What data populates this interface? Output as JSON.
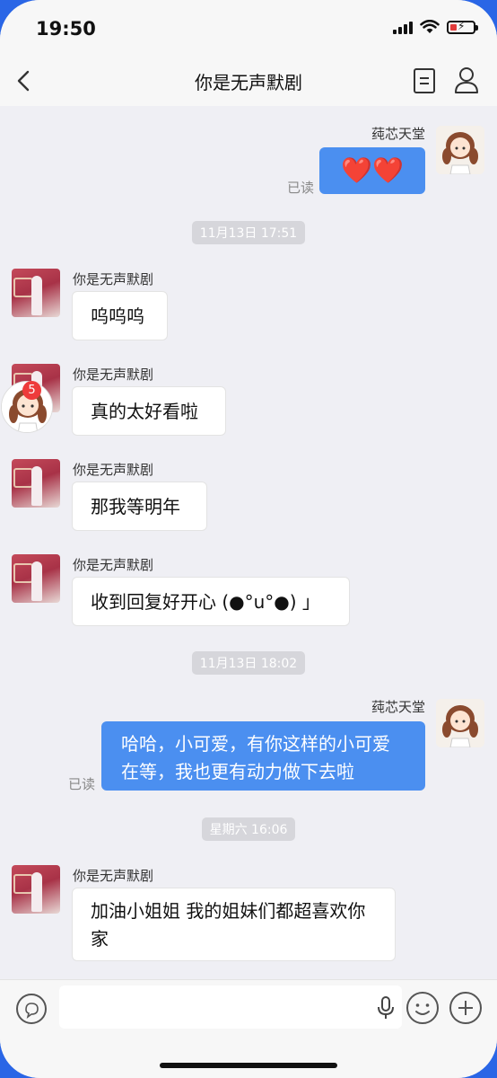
{
  "status_bar": {
    "time": "19:50"
  },
  "header": {
    "title": "你是无声默剧"
  },
  "my_name": "莼芯天堂",
  "their_name": "你是无声默剧",
  "read_label": "已读",
  "messages": [
    {
      "from": "me",
      "text": "❤️❤️",
      "read": true
    },
    {
      "timestamp": "11月13日 17:51"
    },
    {
      "from": "them",
      "text": "呜呜呜"
    },
    {
      "from": "them",
      "text": "真的太好看啦"
    },
    {
      "from": "them",
      "text": "那我等明年"
    },
    {
      "from": "them",
      "text": "收到回复好开心 (●°u°●) 」"
    },
    {
      "timestamp": "11月13日 18:02"
    },
    {
      "from": "me",
      "text": "哈哈，小可爱，有你这样的小可爱在等，我也更有动力做下去啦",
      "read": true
    },
    {
      "timestamp": "星期六 16:06"
    },
    {
      "from": "them",
      "text": "加油小姐姐 我的姐妹们都超喜欢你家"
    }
  ],
  "floating_badge_count": "5",
  "colors": {
    "accent": "#4b8ff0",
    "badge": "#ee3b3b",
    "background": "#efeff4"
  }
}
